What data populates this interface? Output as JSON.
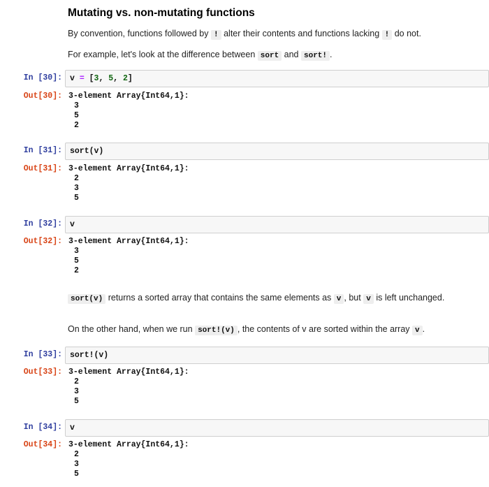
{
  "markdown": {
    "heading": "Mutating vs. non-mutating functions",
    "p1": {
      "a": "By convention, functions followed by",
      "code1": "!",
      "b": "alter their contents and functions lacking",
      "code2": "!",
      "c": "do not."
    },
    "p2": {
      "a": "For example, let's look at the difference between",
      "code1": "sort",
      "b": "and",
      "code2": "sort!",
      "c": "."
    },
    "p3": {
      "code1": "sort(v)",
      "a": "returns a sorted array that contains the same elements as",
      "code2": "v",
      "b": ", but",
      "code3": "v",
      "c": "is left unchanged."
    },
    "p4": {
      "a": "On the other hand, when we run",
      "code1": "sort!(v)",
      "b": ", the contents of v are sorted within the array",
      "code2": "v",
      "c": "."
    }
  },
  "cells": [
    {
      "in_prompt": "In [30]:",
      "code_var": "v",
      "code_op": "=",
      "code_rest_a": "[",
      "n1": "3",
      "n2": "5",
      "n3": "2",
      "code_rest_b": "]",
      "out_prompt": "Out[30]:",
      "out_header": "3-element Array{Int64,1}:",
      "values": [
        "3",
        "5",
        "2"
      ]
    },
    {
      "in_prompt": "In [31]:",
      "code": "sort(v)",
      "out_prompt": "Out[31]:",
      "out_header": "3-element Array{Int64,1}:",
      "values": [
        "2",
        "3",
        "5"
      ]
    },
    {
      "in_prompt": "In [32]:",
      "code": "v",
      "out_prompt": "Out[32]:",
      "out_header": "3-element Array{Int64,1}:",
      "values": [
        "3",
        "5",
        "2"
      ]
    },
    {
      "in_prompt": "In [33]:",
      "code": "sort!(v)",
      "out_prompt": "Out[33]:",
      "out_header": "3-element Array{Int64,1}:",
      "values": [
        "2",
        "3",
        "5"
      ]
    },
    {
      "in_prompt": "In [34]:",
      "code": "v",
      "out_prompt": "Out[34]:",
      "out_header": "3-element Array{Int64,1}:",
      "values": [
        "2",
        "3",
        "5"
      ]
    }
  ]
}
